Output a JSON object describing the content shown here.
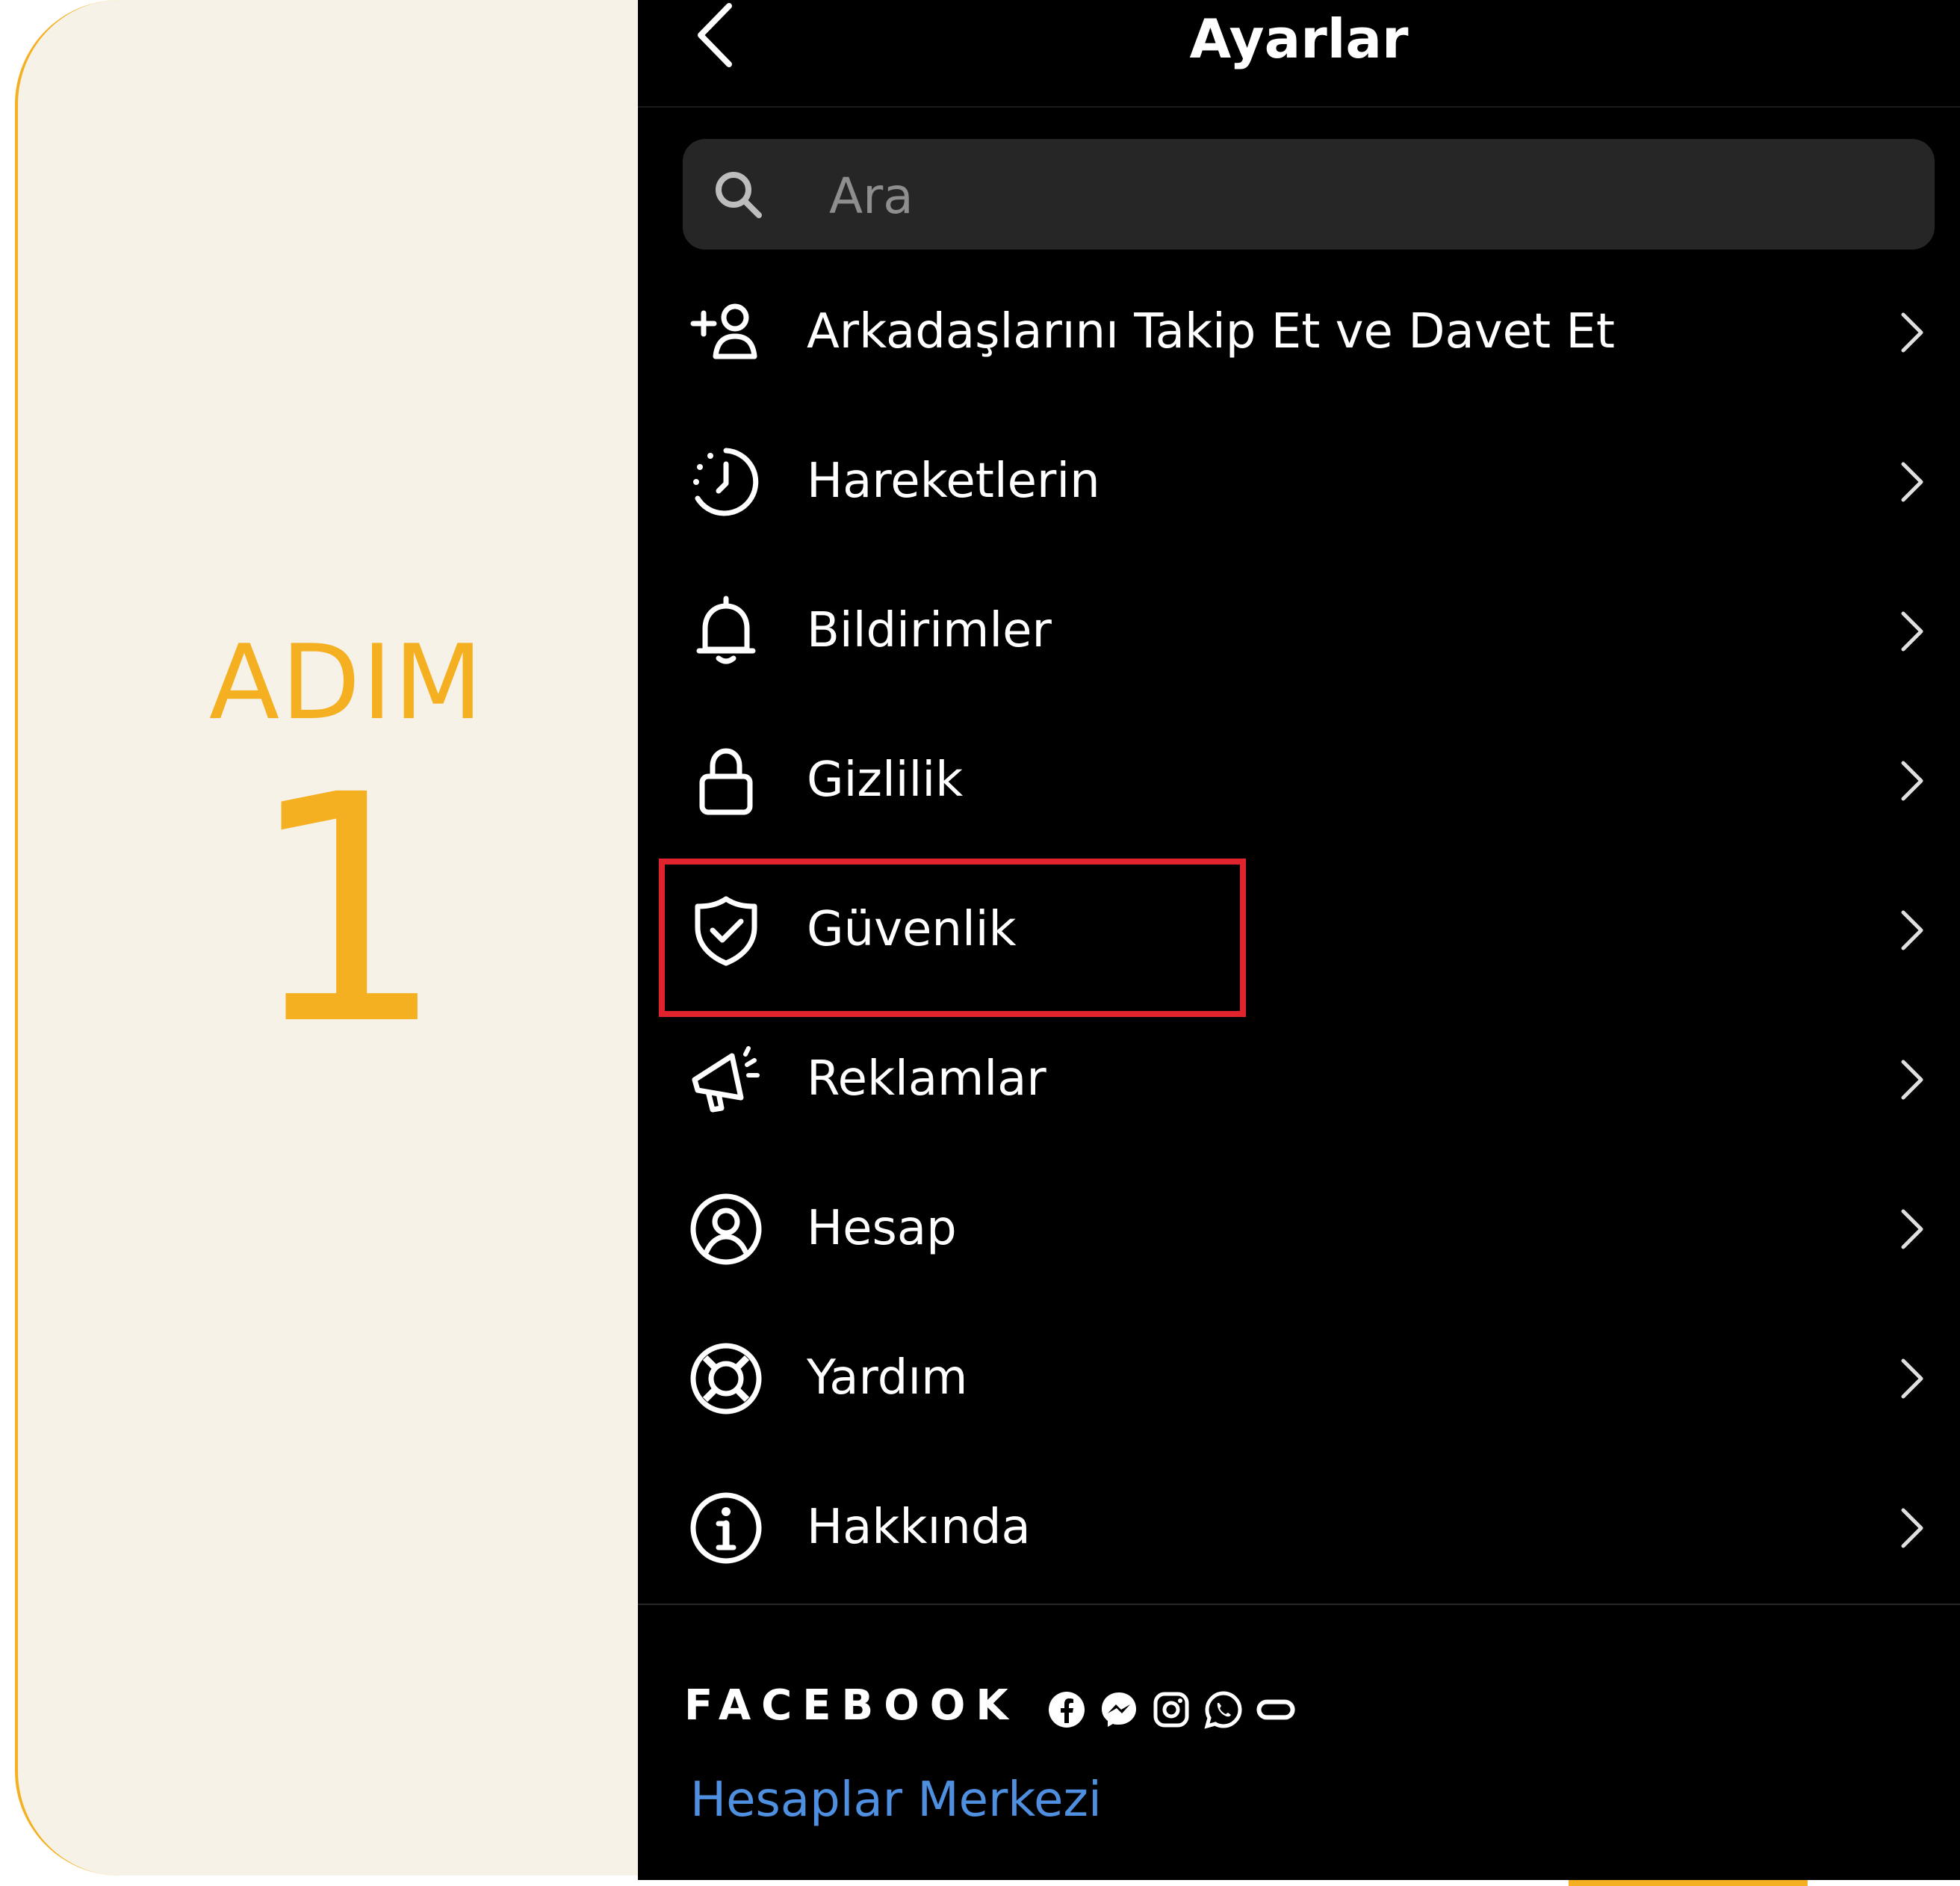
{
  "step": {
    "word": "ADIM",
    "number": "1",
    "accent_color": "#F4B021"
  },
  "header": {
    "title": "Ayarlar",
    "back_icon": "chevron-left-icon"
  },
  "search": {
    "placeholder": "Ara",
    "icon": "search-icon"
  },
  "menu": {
    "items": [
      {
        "label": "Arkadaşlarını Takip Et ve Davet Et",
        "icon": "add-person-icon"
      },
      {
        "label": "Hareketlerin",
        "icon": "activity-clock-icon"
      },
      {
        "label": "Bildirimler",
        "icon": "bell-icon"
      },
      {
        "label": "Gizlilik",
        "icon": "lock-icon"
      },
      {
        "label": "Güvenlik",
        "icon": "shield-check-icon",
        "highlighted": true
      },
      {
        "label": "Reklamlar",
        "icon": "megaphone-icon"
      },
      {
        "label": "Hesap",
        "icon": "account-circle-icon"
      },
      {
        "label": "Yardım",
        "icon": "lifebuoy-icon"
      },
      {
        "label": "Hakkında",
        "icon": "info-icon"
      }
    ]
  },
  "footer": {
    "brand": "FACEBOOK",
    "app_icons": [
      "facebook-icon",
      "messenger-icon",
      "instagram-icon",
      "whatsapp-icon",
      "oculus-icon"
    ],
    "link": "Hesaplar Merkezi",
    "link_color": "#4F8FE0"
  },
  "highlight_color": "#E1232E"
}
